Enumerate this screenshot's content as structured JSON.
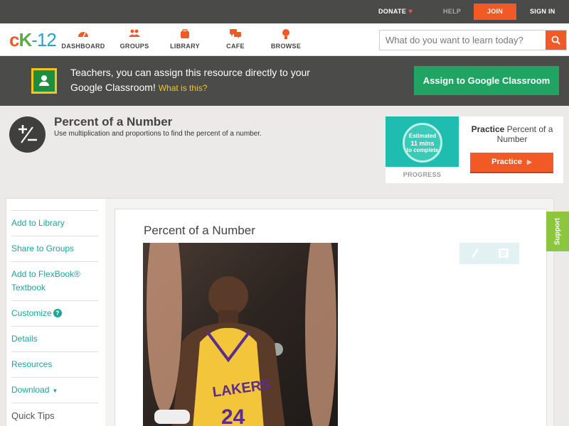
{
  "topbar": {
    "donate": "DONATE",
    "help": "HELP",
    "join": "JOIN",
    "signin": "SIGN IN"
  },
  "logo": {
    "c": "c",
    "k": "K",
    "n": "-12"
  },
  "nav": {
    "items": [
      {
        "label": "DASHBOARD",
        "icon": "dashboard-icon"
      },
      {
        "label": "GROUPS",
        "icon": "groups-icon"
      },
      {
        "label": "LIBRARY",
        "icon": "library-icon"
      },
      {
        "label": "CAFE",
        "icon": "cafe-icon"
      },
      {
        "label": "BROWSE",
        "icon": "browse-icon"
      }
    ],
    "search_placeholder": "What do you want to learn today?"
  },
  "banner": {
    "text": "Teachers, you can assign this resource directly to your Google Classroom!",
    "what": "What is this?",
    "assign": "Assign to Google Classroom"
  },
  "concept": {
    "title": "Percent of a Number",
    "subtitle": "Use multiplication and proportions to find the percent of a number."
  },
  "practice": {
    "estimated": "Estimated",
    "mins": "11 mins",
    "to_complete": "to complete",
    "progress": "PROGRESS",
    "head_bold": "Practice",
    "head_rest": "Percent of a Number",
    "button": "Practice"
  },
  "sidebar": {
    "items": [
      "Add to Library",
      "Share to Groups",
      "Add to FlexBook® Textbook",
      "Customize",
      "Details",
      "Resources",
      "Download",
      "Quick Tips"
    ]
  },
  "content": {
    "title": "Percent of a Number"
  },
  "support": "Support",
  "colors": {
    "accent": "#f15a24",
    "teal": "#1aa59c",
    "green": "#1fa463",
    "support": "#8cc63f"
  }
}
